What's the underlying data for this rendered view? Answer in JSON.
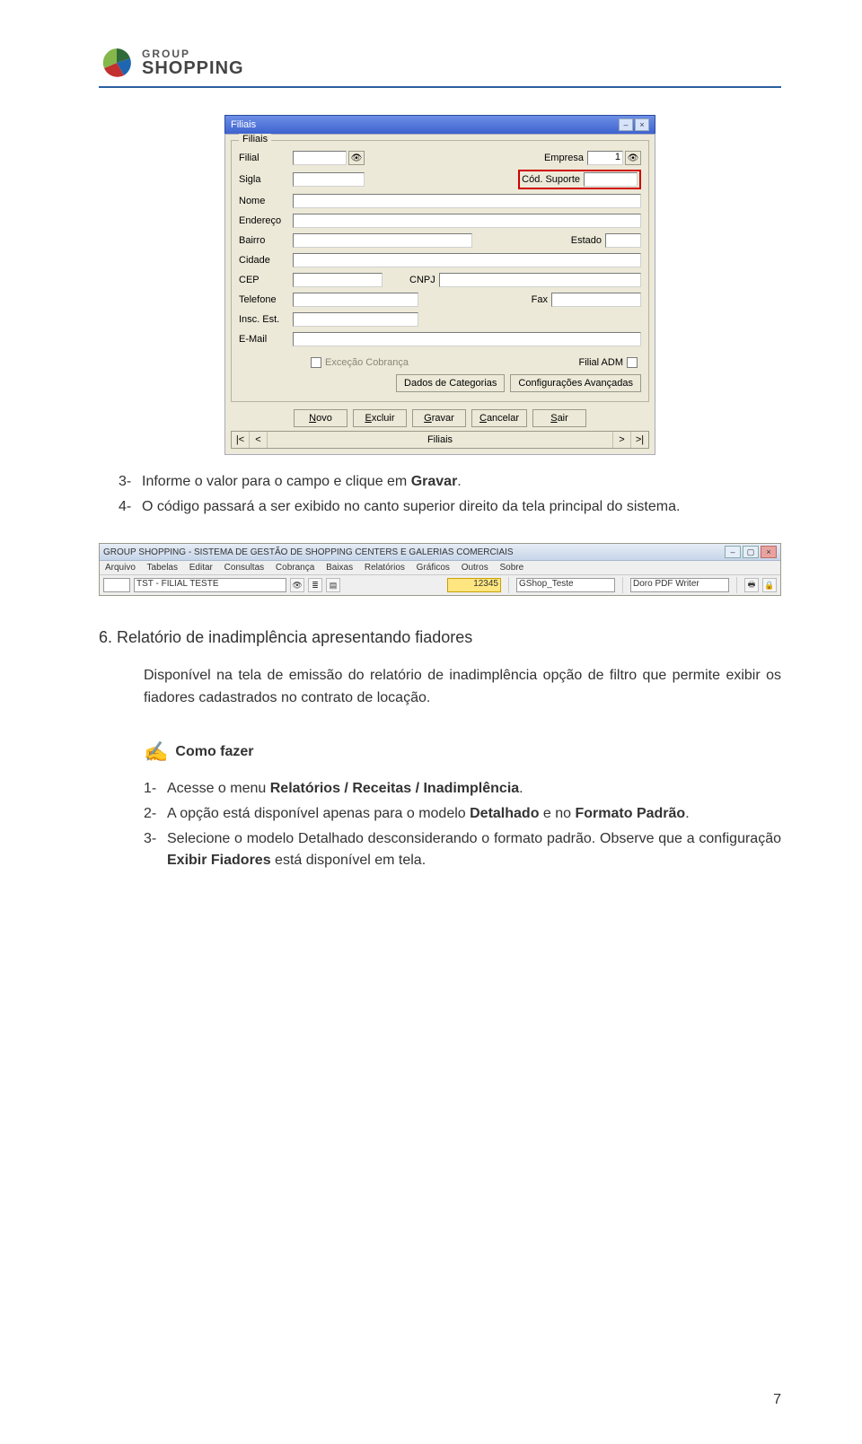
{
  "header": {
    "brand_top": "GROUP",
    "brand_bottom": "SHOPPING"
  },
  "dialog": {
    "title": "Filiais",
    "group_title": "Filiais",
    "labels": {
      "filial": "Filial",
      "empresa": "Empresa",
      "sigla": "Sigla",
      "cod_suporte": "Cód. Suporte",
      "nome": "Nome",
      "endereco": "Endereço",
      "bairro": "Bairro",
      "estado": "Estado",
      "cidade": "Cidade",
      "cep": "CEP",
      "cnpj": "CNPJ",
      "telefone": "Telefone",
      "fax": "Fax",
      "insc_est": "Insc. Est.",
      "email": "E-Mail",
      "excecao_cobranca": "Exceção Cobrança",
      "filial_adm": "Filial ADM"
    },
    "values": {
      "empresa": "1"
    },
    "buttons": {
      "dados_categorias": "Dados de Categorias",
      "config_avancadas": "Configurações Avançadas",
      "novo": "Novo",
      "excluir": "Excluir",
      "gravar": "Gravar",
      "cancelar": "Cancelar",
      "sair": "Sair"
    },
    "nav": {
      "first": "|<",
      "prev": "<",
      "label": "Filiais",
      "next": ">",
      "last": ">|"
    }
  },
  "body": {
    "step3_num": "3-",
    "step3_text_a": "Informe o valor para o campo e clique em ",
    "step3_text_b": "Gravar",
    "step3_text_c": ".",
    "step4_num": "4-",
    "step4_text": "O código passará a ser exibido no canto superior direito da tela principal do sistema."
  },
  "appbar": {
    "title": "GROUP SHOPPING - SISTEMA DE GESTÃO DE SHOPPING CENTERS E GALERIAS COMERCIAIS",
    "menu": [
      "Arquivo",
      "Tabelas",
      "Editar",
      "Consultas",
      "Cobrança",
      "Baixas",
      "Relatórios",
      "Gráficos",
      "Outros",
      "Sobre"
    ],
    "field1": "TST - FILIAL TESTE",
    "field2": "12345",
    "field3": "GShop_Teste",
    "field4": "Doro PDF Writer"
  },
  "section6": {
    "num": "6.",
    "title": "Relatório de inadimplência apresentando fiadores",
    "desc": "Disponível na tela de emissão do relatório de inadimplência opção de filtro que permite exibir os fiadores cadastrados no contrato de locação."
  },
  "howto": {
    "label": "Como fazer"
  },
  "steps": {
    "s1_num": "1-",
    "s1_a": "Acesse o menu ",
    "s1_b": "Relatórios / Receitas / Inadimplência",
    "s1_c": ".",
    "s2_num": "2-",
    "s2_a": "A opção está disponível apenas para o modelo ",
    "s2_b": "Detalhado",
    "s2_c": " e no ",
    "s2_d": "Formato Padrão",
    "s2_e": ".",
    "s3_num": "3-",
    "s3_a": "Selecione o modelo Detalhado desconsiderando o formato padrão. Observe que a configuração ",
    "s3_b": "Exibir Fiadores",
    "s3_c": " está disponível em tela."
  },
  "page_num": "7"
}
